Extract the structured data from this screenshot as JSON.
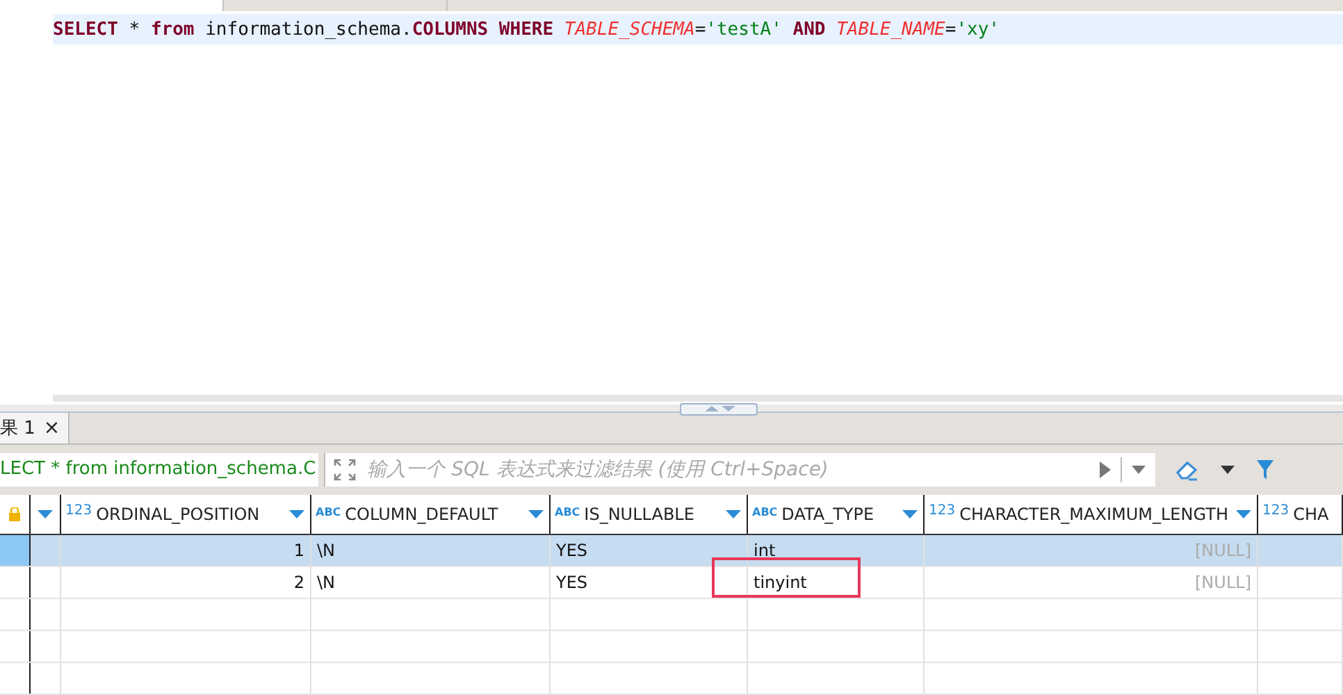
{
  "editor": {
    "lines": [
      {
        "current": true,
        "tokens": [
          {
            "kind": "keyword",
            "text": "SELECT"
          },
          {
            "kind": "plain",
            "text": " * "
          },
          {
            "kind": "keyword",
            "text": "from"
          },
          {
            "kind": "plain",
            "text": " information_schema."
          },
          {
            "kind": "keyword",
            "text": "COLUMNS"
          },
          {
            "kind": "keyword",
            "text": " WHERE"
          },
          {
            "kind": "field",
            "text": " TABLE_SCHEMA"
          },
          {
            "kind": "plain",
            "text": "="
          },
          {
            "kind": "string",
            "text": "'testA'"
          },
          {
            "kind": "keyword",
            "text": " AND"
          },
          {
            "kind": "field",
            "text": " TABLE_NAME"
          },
          {
            "kind": "plain",
            "text": "="
          },
          {
            "kind": "string",
            "text": "'xy'"
          }
        ]
      }
    ]
  },
  "results": {
    "tabs": [
      {
        "label": "果 1",
        "close": "×",
        "selected": true
      }
    ],
    "query_text": "LECT * from information_schema.C",
    "filter": {
      "placeholder": "输入一个 SQL 表达式来过滤结果 (使用 Ctrl+Space)"
    },
    "columns": [
      {
        "kind": "number",
        "badge": "123",
        "name": "ORDINAL_POSITION"
      },
      {
        "kind": "text",
        "badge": "ABC",
        "name": "COLUMN_DEFAULT"
      },
      {
        "kind": "text",
        "badge": "ABC",
        "name": "IS_NULLABLE"
      },
      {
        "kind": "text",
        "badge": "ABC",
        "name": "DATA_TYPE"
      },
      {
        "kind": "number",
        "badge": "123",
        "name": "CHARACTER_MAXIMUM_LENGTH"
      },
      {
        "kind": "number",
        "badge": "123",
        "name": "CHA"
      }
    ],
    "rows": [
      {
        "selected": true,
        "cells": [
          {
            "text": "1",
            "null": false,
            "boxed": false
          },
          {
            "text": "\\N",
            "null": false,
            "boxed": false
          },
          {
            "text": "YES",
            "null": false,
            "boxed": false
          },
          {
            "text": "int",
            "null": false,
            "boxed": false
          },
          {
            "text": "[NULL]",
            "null": true,
            "boxed": false
          }
        ]
      },
      {
        "selected": false,
        "cells": [
          {
            "text": "2",
            "null": false,
            "boxed": false
          },
          {
            "text": "\\N",
            "null": false,
            "boxed": false
          },
          {
            "text": "YES",
            "null": false,
            "boxed": false
          },
          {
            "text": "tinyint",
            "null": false,
            "boxed": true
          },
          {
            "text": "[NULL]",
            "null": true,
            "boxed": false
          }
        ]
      }
    ]
  }
}
